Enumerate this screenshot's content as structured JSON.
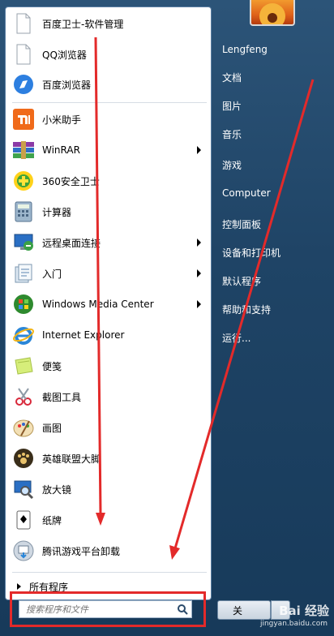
{
  "programs": [
    {
      "label": "百度卫士-软件管理",
      "icon": "blank-file-icon"
    },
    {
      "label": "QQ浏览器",
      "icon": "blank-file-icon"
    },
    {
      "label": "百度浏览器",
      "icon": "baidu-browser-icon"
    },
    {
      "label": "小米助手",
      "icon": "xiaomi-icon"
    },
    {
      "label": "WinRAR",
      "icon": "winrar-icon",
      "submenu": true
    },
    {
      "label": "360安全卫士",
      "icon": "360-icon"
    },
    {
      "label": "计算器",
      "icon": "calculator-icon"
    },
    {
      "label": "远程桌面连接",
      "icon": "remote-desktop-icon",
      "submenu": true
    },
    {
      "label": "入门",
      "icon": "getting-started-icon",
      "submenu": true
    },
    {
      "label": "Windows Media Center",
      "icon": "media-center-icon",
      "submenu": true
    },
    {
      "label": "Internet Explorer",
      "icon": "ie-icon"
    },
    {
      "label": "便笺",
      "icon": "sticky-notes-icon"
    },
    {
      "label": "截图工具",
      "icon": "snipping-tool-icon"
    },
    {
      "label": "画图",
      "icon": "paint-icon"
    },
    {
      "label": "英雄联盟大脚",
      "icon": "paw-icon"
    },
    {
      "label": "放大镜",
      "icon": "magnifier-icon"
    },
    {
      "label": "纸牌",
      "icon": "solitaire-icon"
    },
    {
      "label": "腾讯游戏平台卸载",
      "icon": "uninstall-icon"
    }
  ],
  "all_programs": "所有程序",
  "search": {
    "placeholder": "搜索程序和文件"
  },
  "right": {
    "user": "Lengfeng",
    "items": [
      "文档",
      "图片",
      "音乐",
      "游戏",
      "Computer",
      "控制面板",
      "设备和打印机",
      "默认程序",
      "帮助和支持",
      "运行..."
    ]
  },
  "shutdown_label": "关",
  "watermark": {
    "text": "Bai 经验",
    "url": "jingyan.baidu.com"
  },
  "colors": {
    "annotation_red": "#e32a2a",
    "panel_blue": "#1f4466"
  }
}
